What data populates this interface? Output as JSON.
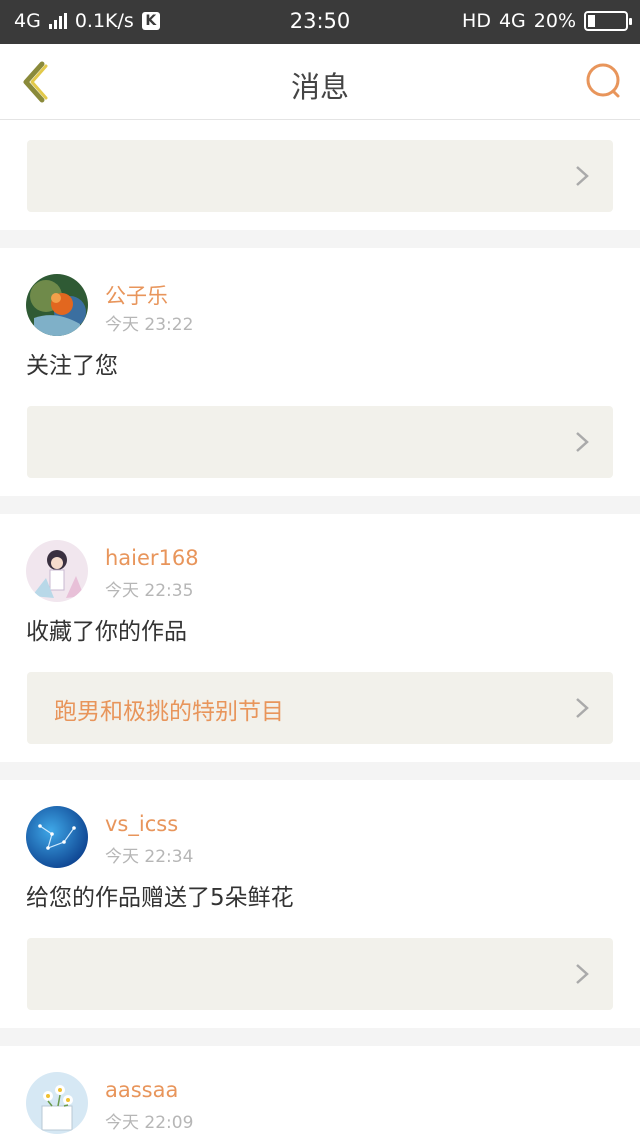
{
  "status_bar": {
    "network": "4G",
    "speed": "0.1K/s",
    "k_badge": "K",
    "time": "23:50",
    "hd": "HD",
    "network_right": "4G",
    "battery_percent": "20%",
    "battery_level": 0.2
  },
  "nav": {
    "title": "消息",
    "back_icon": "chevron-left-icon",
    "search_icon": "search-icon"
  },
  "colors": {
    "accent": "#e8955b",
    "back_icon": "#8a8a3a",
    "status_bar": "#3a3a3a",
    "link_box": "#f2f1eb"
  },
  "messages": [
    {
      "user": "公子乐",
      "time": "今天 23:22",
      "action": "关注了您",
      "link": ""
    },
    {
      "user": "haier168",
      "time": "今天 22:35",
      "action": "收藏了你的作品",
      "link": "跑男和极挑的特别节目"
    },
    {
      "user": "vs_icss",
      "time": "今天 22:34",
      "action": "给您的作品赠送了5朵鲜花",
      "link": ""
    },
    {
      "user": "aassaa",
      "time": "今天 22:09",
      "action": "",
      "link": ""
    }
  ]
}
